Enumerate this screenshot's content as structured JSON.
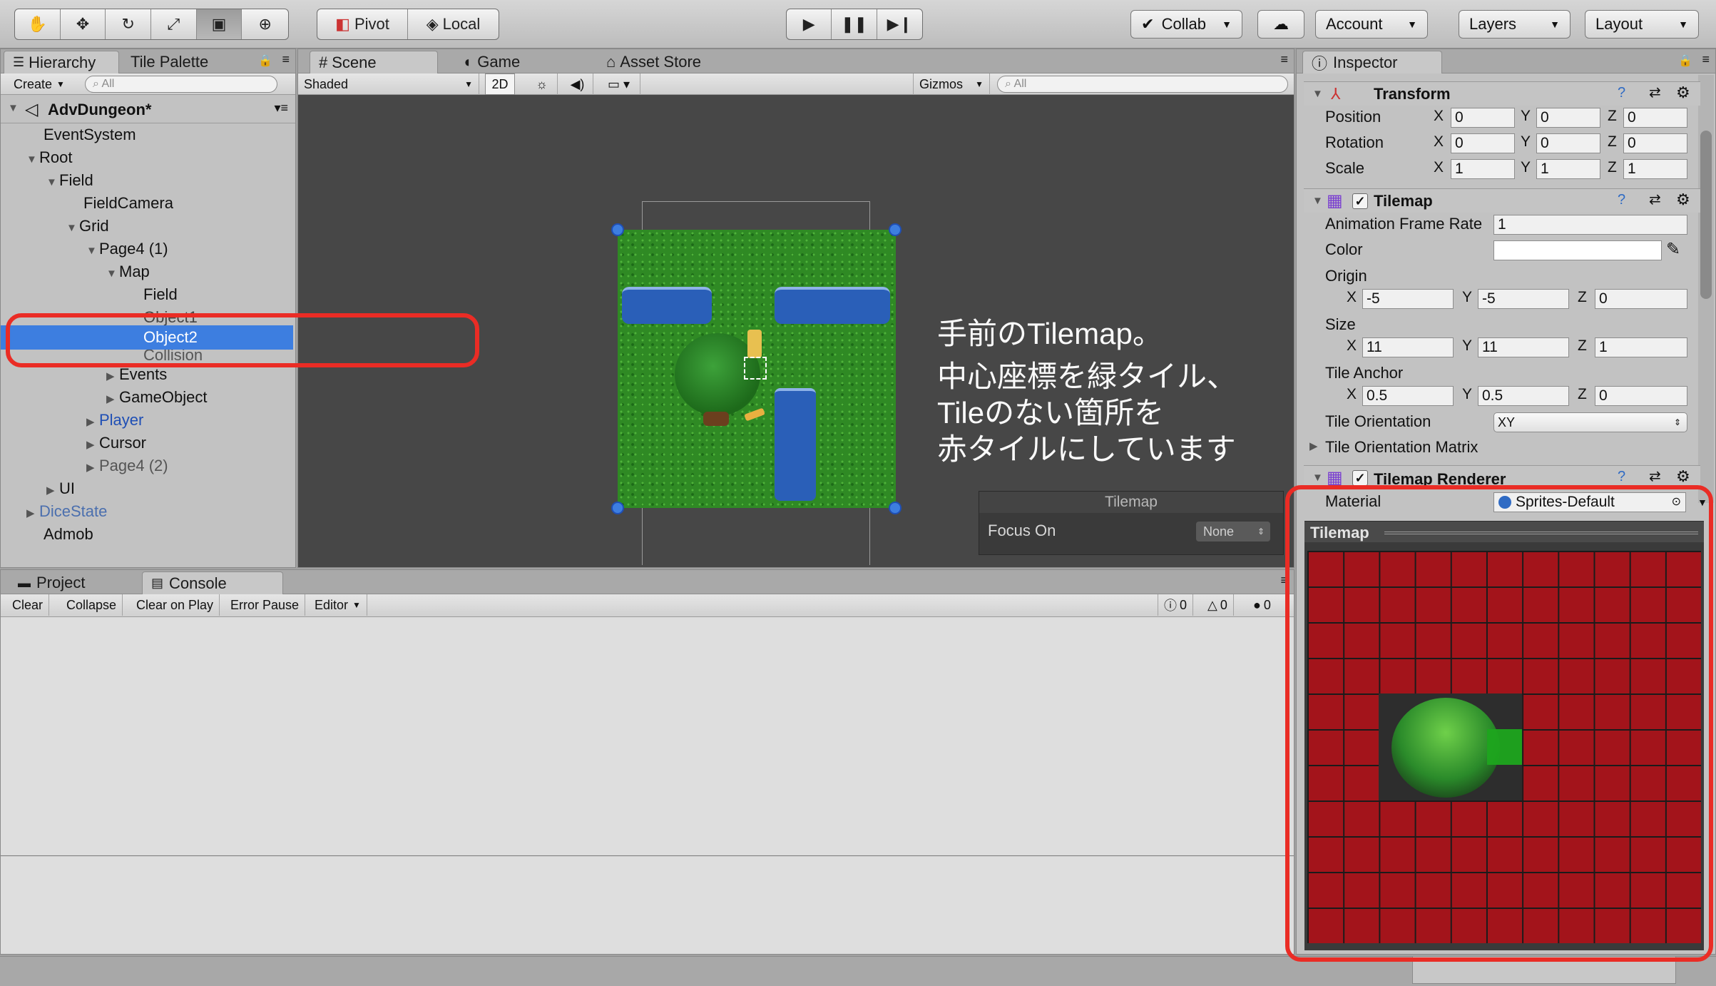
{
  "toolbar": {
    "pivot": "Pivot",
    "local": "Local",
    "collab": "Collab",
    "account": "Account",
    "layers": "Layers",
    "layout": "Layout"
  },
  "hierarchy": {
    "tabs": [
      "Hierarchy",
      "Tile Palette"
    ],
    "create": "Create",
    "search_placeholder": "All",
    "scene_name": "AdvDungeon*",
    "items": [
      {
        "label": "EventSystem"
      },
      {
        "label": "Root"
      },
      {
        "label": "Field"
      },
      {
        "label": "FieldCamera"
      },
      {
        "label": "Grid"
      },
      {
        "label": "Page4 (1)"
      },
      {
        "label": "Map"
      },
      {
        "label": "Field"
      },
      {
        "label": "Object1"
      },
      {
        "label": "Object2"
      },
      {
        "label": "Collision"
      },
      {
        "label": "Events"
      },
      {
        "label": "GameObject"
      },
      {
        "label": "Player"
      },
      {
        "label": "Cursor"
      },
      {
        "label": "Page4 (2)"
      },
      {
        "label": "UI"
      },
      {
        "label": "DiceState"
      },
      {
        "label": "Admob"
      }
    ]
  },
  "scene": {
    "tabs": [
      "Scene",
      "Game",
      "Asset Store"
    ],
    "shading": "Shaded",
    "mode_2d": "2D",
    "gizmos": "Gizmos",
    "search_placeholder": "All",
    "annotation": [
      "手前のTilemap。",
      "中心座標を緑タイル、",
      "Tileのない箇所を",
      "赤タイルにしています"
    ],
    "overlay": {
      "title": "Tilemap",
      "focus_label": "Focus On",
      "focus_value": "None"
    }
  },
  "console": {
    "tabs": [
      "Project",
      "Console"
    ],
    "buttons": [
      "Clear",
      "Collapse",
      "Clear on Play",
      "Error Pause",
      "Editor"
    ],
    "counts": {
      "log": "0",
      "warn": "0",
      "error": "0"
    }
  },
  "inspector": {
    "tab": "Inspector",
    "transform": {
      "title": "Transform",
      "position": {
        "label": "Position",
        "x": "0",
        "y": "0",
        "z": "0"
      },
      "rotation": {
        "label": "Rotation",
        "x": "0",
        "y": "0",
        "z": "0"
      },
      "scale": {
        "label": "Scale",
        "x": "1",
        "y": "1",
        "z": "1"
      }
    },
    "tilemap": {
      "title": "Tilemap",
      "anim_label": "Animation Frame Rate",
      "anim_value": "1",
      "color_label": "Color",
      "origin_label": "Origin",
      "origin": {
        "x": "-5",
        "y": "-5",
        "z": "0"
      },
      "size_label": "Size",
      "size": {
        "x": "11",
        "y": "11",
        "z": "1"
      },
      "anchor_label": "Tile Anchor",
      "anchor": {
        "x": "0.5",
        "y": "0.5",
        "z": "0"
      },
      "orientation_label": "Tile Orientation",
      "orientation_value": "XY",
      "matrix_label": "Tile Orientation Matrix"
    },
    "renderer": {
      "title": "Tilemap Renderer",
      "material_label": "Material",
      "material_value": "Sprites-Default"
    },
    "preview_title": "Tilemap"
  },
  "colors": {
    "selection": "#3d7ee0",
    "highlight": "#ea2c25",
    "tile_red": "#a3141b",
    "tile_green": "#1ea51e"
  }
}
